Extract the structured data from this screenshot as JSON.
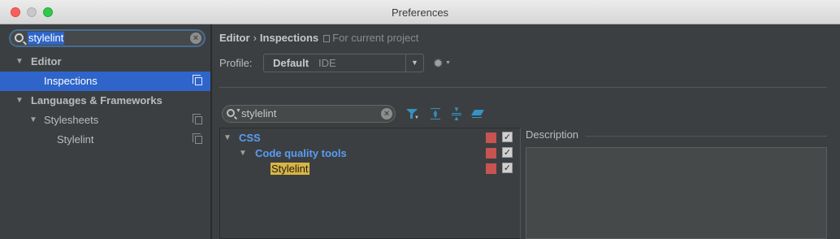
{
  "window": {
    "title": "Preferences"
  },
  "sidebar": {
    "search_value": "stylelint",
    "items": [
      {
        "label": "Editor"
      },
      {
        "label": "Inspections"
      },
      {
        "label": "Languages & Frameworks"
      },
      {
        "label": "Stylesheets"
      },
      {
        "label": "Stylelint"
      }
    ]
  },
  "breadcrumb": {
    "root": "Editor",
    "separator": "›",
    "current": "Inspections",
    "scope": "For current project"
  },
  "profile": {
    "label": "Profile:",
    "name": "Default",
    "scope": "IDE"
  },
  "inspections": {
    "filter_value": "stylelint",
    "tree": [
      {
        "label": "CSS",
        "severity_color": "#c75450",
        "checked": true
      },
      {
        "label": "Code quality tools",
        "severity_color": "#c75450",
        "checked": true
      },
      {
        "label": "Stylelint",
        "severity_color": "#c75450",
        "checked": true
      }
    ]
  },
  "description": {
    "title": "Description"
  },
  "colors": {
    "selection": "#2f65ca",
    "link": "#589df6",
    "highlight": "#d9b543",
    "accent": "#3592c4"
  }
}
